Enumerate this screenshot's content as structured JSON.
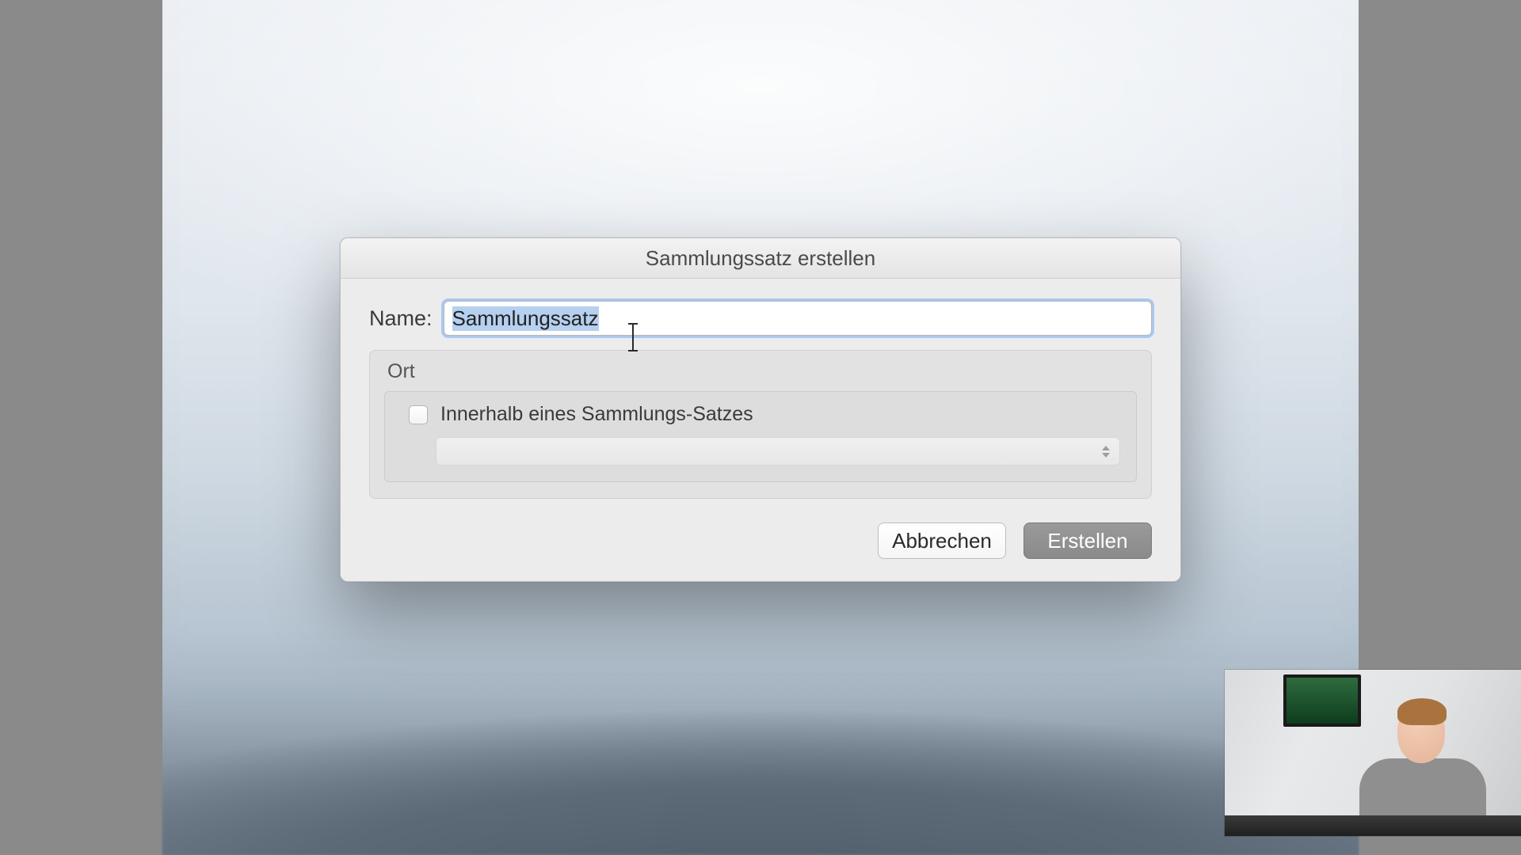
{
  "dialog": {
    "title": "Sammlungssatz erstellen",
    "name_label": "Name:",
    "name_value": "Sammlungssatz",
    "ort": {
      "title": "Ort",
      "checkbox_label": "Innerhalb eines Sammlungs-Satzes",
      "checkbox_checked": false,
      "select_value": ""
    },
    "buttons": {
      "cancel": "Abbrechen",
      "create": "Erstellen"
    }
  }
}
